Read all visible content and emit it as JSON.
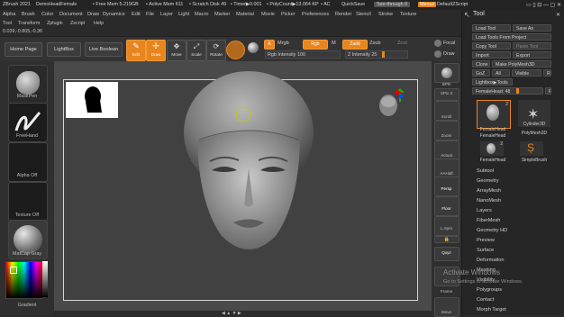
{
  "titlebar": {
    "app": "ZBrush 2021",
    "doc": "DemoHeadFemale",
    "free_mem": "• Free Mem 5.219GB",
    "active_mem": "• Active Mem 611",
    "scratch": "• Scratch Disk 49",
    "timer": "• Timer▶0.001",
    "polycount": "• PolyCount▶13.064 KP",
    "ac": "• AC",
    "quicksave": "QuickSave",
    "seethrough": "See-through 0",
    "menus_btn": "Menus",
    "default_script": "DefaultZScript"
  },
  "menu": [
    "Alpha",
    "Brush",
    "Color",
    "Document",
    "Draw",
    "Dynamics",
    "Edit",
    "File",
    "Layer",
    "Light",
    "Macro",
    "Marker",
    "Material",
    "Movie",
    "Picker",
    "Preferences",
    "Render",
    "Stencil",
    "Stroke",
    "Texture"
  ],
  "submenu": [
    "Tool",
    "Transform",
    "Zplugin",
    "Zscript",
    "Help"
  ],
  "coords": "0.039,-0.805,-0.36",
  "shelf": {
    "home": "Home Page",
    "lightbox": "LightBox",
    "live_boolean": "Live Boolean",
    "edit": "Edit",
    "draw": "Draw",
    "move": "Move",
    "scale": "Scale",
    "rotate": "Rotate",
    "a": "A",
    "mrgb": "Mrgb",
    "rgb": "Rgb",
    "m": "M",
    "zadd": "Zadd",
    "zsub": "Zsub",
    "zcut": "Zcut",
    "focal": "Focal",
    "draw_size": "Draw",
    "rgb_intensity": "Rgb Intensity 100",
    "z_intensity": "Z Intensity 25"
  },
  "left_tray": {
    "maskpen": "MaskPen",
    "freehand": "FreeHand",
    "alpha_off": "Alpha Off",
    "texture_off": "Texture Off",
    "matcap": "MatCap Gray",
    "gradient": "Gradient"
  },
  "right_strip": [
    "BPR",
    "SPix 3",
    "Scroll",
    "Zoom",
    "Actual",
    "AAHalf",
    "Persp",
    "Floor",
    "L.Sym",
    "Qxyz",
    "Frame",
    "Move"
  ],
  "tool_panel": {
    "header": "Tool",
    "load_tool": "Load Tool",
    "save_as": "Save As",
    "load_from_project": "Load Tools From Project",
    "copy_tool": "Copy Tool",
    "paste_tool": "Paste Tool",
    "import": "Import",
    "export": "Export",
    "clone": "Clone",
    "make_polymesh": "Make PolyMesh3D",
    "goz": "GoZ",
    "all": "All",
    "visible": "Visible",
    "r": "R",
    "lightbox_tools": "Lightbox▶Tools",
    "current_tool": "FemaleHead: 48",
    "tools": [
      {
        "name": "FemaleHead",
        "count": "2"
      },
      {
        "name": "Cylinder3D",
        "count": ""
      },
      {
        "name": "FemaleHead",
        "count": ""
      },
      {
        "name": "PolyMesh3D",
        "count": ""
      },
      {
        "name": "FemaleHead",
        "count": "2"
      },
      {
        "name": "SimpleBrush",
        "count": ""
      }
    ],
    "sections": [
      "Subtool",
      "Geometry",
      "ArrayMesh",
      "NanoMesh",
      "Layers",
      "FiberMesh",
      "Geometry HD",
      "Preview",
      "Surface",
      "Deformation",
      "Masking",
      "Visibility",
      "Polygroups",
      "Contact",
      "Morph Target"
    ]
  },
  "watermark": {
    "title": "Activate Windows",
    "subtitle": "Go to Settings to activate Windows."
  },
  "colors": {
    "accent": "#e8851e",
    "viewport_bg": "#414141"
  }
}
